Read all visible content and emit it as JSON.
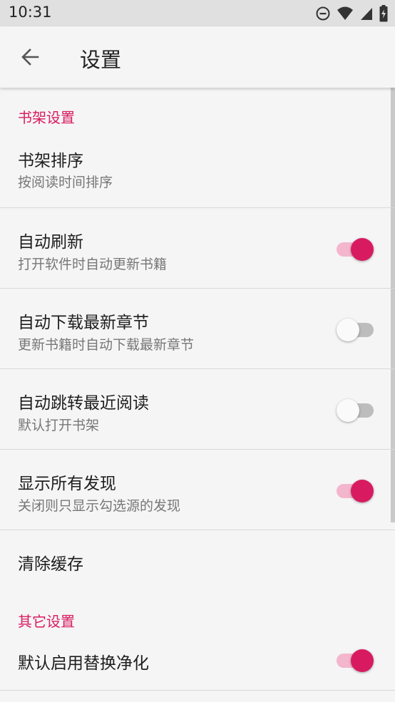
{
  "status": {
    "time": "10:31"
  },
  "appbar": {
    "title": "设置"
  },
  "sections": {
    "bookshelf": {
      "header": "书架设置"
    },
    "other": {
      "header": "其它设置"
    }
  },
  "items": {
    "sort": {
      "label": "书架排序",
      "summary": "按阅读时间排序"
    },
    "auto_refresh": {
      "label": "自动刷新",
      "summary": "打开软件时自动更新书籍",
      "on": true
    },
    "auto_download": {
      "label": "自动下载最新章节",
      "summary": "更新书籍时自动下载最新章节",
      "on": false
    },
    "auto_jump": {
      "label": "自动跳转最近阅读",
      "summary": "默认打开书架",
      "on": false
    },
    "show_all": {
      "label": "显示所有发现",
      "summary": "关闭则只显示勾选源的发现",
      "on": true
    },
    "clear_cache": {
      "label": "清除缓存"
    },
    "replace_purify": {
      "label": "默认启用替换净化",
      "on": true
    }
  },
  "colors": {
    "accent": "#d81b60",
    "accent_track": "#f3b6cc"
  }
}
